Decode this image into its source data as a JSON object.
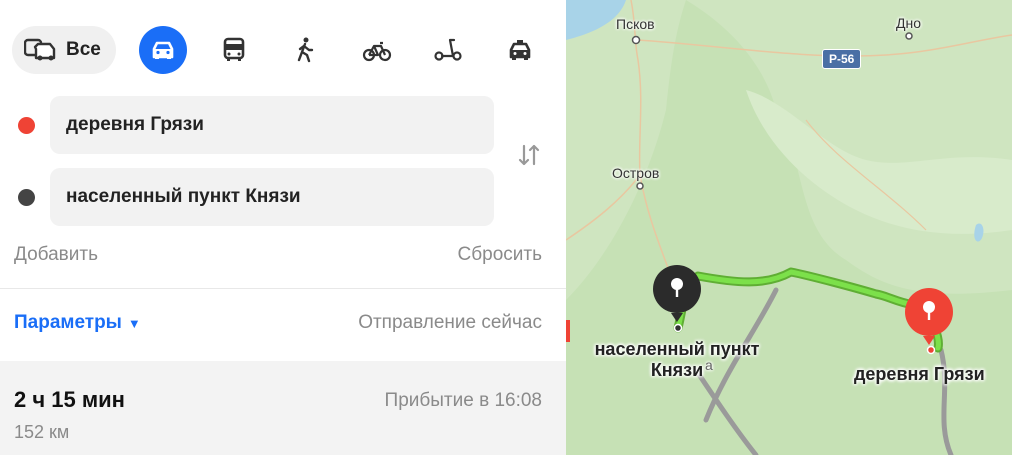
{
  "modes": {
    "all_label": "Все",
    "items": [
      {
        "name": "car",
        "active": true
      },
      {
        "name": "bus",
        "active": false
      },
      {
        "name": "walk",
        "active": false
      },
      {
        "name": "bike",
        "active": false
      },
      {
        "name": "scooter",
        "active": false
      },
      {
        "name": "taxi",
        "active": false
      }
    ]
  },
  "route": {
    "from": {
      "value": "деревня Грязи",
      "color": "#ef4335"
    },
    "to": {
      "value": "населенный пункт Князи",
      "color": "#444444"
    },
    "add_label": "Добавить",
    "reset_label": "Сбросить",
    "params_label": "Параметры",
    "departure_label": "Отправление сейчас",
    "duration": "2 ч 15 мин",
    "distance": "152 км",
    "arrival": "Прибытие в 16:08"
  },
  "map": {
    "labels": {
      "pskov": "Псков",
      "dno": "Дно",
      "ostrov": "Остров",
      "road": "Р-56",
      "small": "а"
    },
    "markers": {
      "start_label": "деревня Грязи",
      "end_label_line1": "населенный пункт",
      "end_label_line2": "Князи"
    },
    "colors": {
      "route": "#6fd03c",
      "start_pin": "#ef4335",
      "end_pin": "#2b2b2b",
      "accent": "#1a6ef7"
    }
  }
}
